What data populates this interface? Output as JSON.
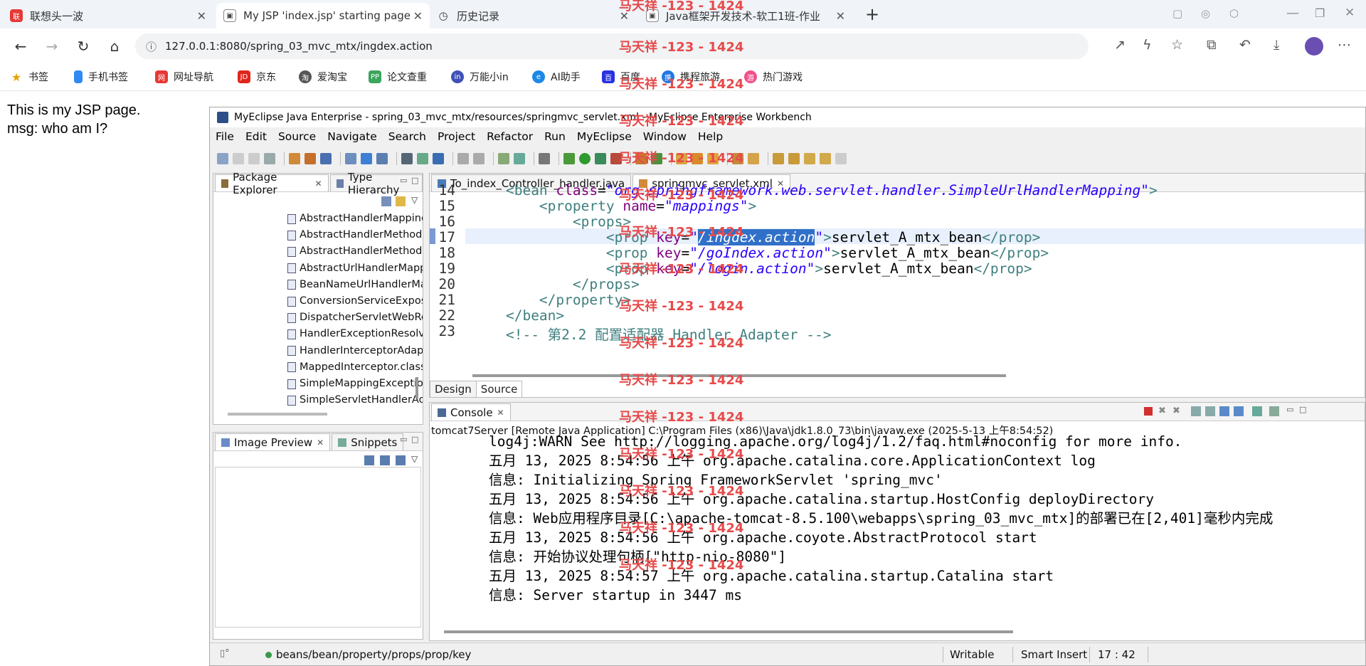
{
  "browser": {
    "tabs": [
      {
        "title": "联想头一波",
        "icon": "lenovo-icon"
      },
      {
        "title": "My JSP 'index.jsp' starting page",
        "icon": "page-icon"
      },
      {
        "title": "历史记录",
        "icon": "history-icon"
      },
      {
        "title": "Java框架开发技术-软工1班-作业",
        "icon": "page-icon"
      }
    ],
    "url": "127.0.0.1:8080/spring_03_mvc_mtx/ingdex.action",
    "bookmarks": [
      "书签",
      "手机书签",
      "网址导航",
      "京东",
      "爱淘宝",
      "论文查重",
      "万能小in",
      "AI助手",
      "百度",
      "携程旅游",
      "热门游戏"
    ]
  },
  "page": {
    "line1": "This is my JSP page.",
    "line2": "msg: who am I?"
  },
  "ide": {
    "title": "MyEclipse Java Enterprise - spring_03_mvc_mtx/resources/springmvc_servlet.xml - MyEclipse Enterprise Workbench",
    "menu": [
      "File",
      "Edit",
      "Source",
      "Navigate",
      "Search",
      "Project",
      "Refactor",
      "Run",
      "MyEclipse",
      "Window",
      "Help"
    ],
    "left_top_tabs": [
      "Package Explorer",
      "Type Hierarchy"
    ],
    "tree_items": [
      "AbstractHandlerMapping.class",
      "AbstractHandlerMethodExcepti",
      "AbstractHandlerMethodMappin",
      "AbstractUrlHandlerMapping.clas",
      "BeanNameUrlHandlerMapping.c",
      "ConversionServiceExposingInter",
      "DispatcherServletWebRequest.c",
      "HandlerExceptionResolverComp",
      "HandlerInterceptorAdapter.class",
      "MappedInterceptor.class",
      "SimpleMappingExceptionResolv",
      "SimpleServletHandlerAdapter.cl"
    ],
    "left_bottom_tabs": [
      "Image Preview",
      "Snippets"
    ],
    "editor_tabs": [
      "To_index_Controller_handler.java",
      "springmvc_servlet.xml"
    ],
    "code_lines": [
      {
        "n": "14",
        "indent": "    ",
        "text": "<bean class=\"org.springframework.web.servlet.handler.SimpleUrlHandlerMapping\">"
      },
      {
        "n": "15",
        "indent": "        ",
        "text": "<property name=\"mappings\">"
      },
      {
        "n": "16",
        "indent": "            ",
        "text": "<props>"
      },
      {
        "n": "17",
        "indent": "                ",
        "text": "<prop key=\"/ingdex.action\">servlet_A_mtx_bean</prop>"
      },
      {
        "n": "18",
        "indent": "                ",
        "text": "<prop key=\"/goIndex.action\">servlet_A_mtx_bean</prop>"
      },
      {
        "n": "19",
        "indent": "                ",
        "text": "<prop key=\"/login.action\">servlet_A_mtx_bean</prop>"
      },
      {
        "n": "20",
        "indent": "            ",
        "text": "</props>"
      },
      {
        "n": "21",
        "indent": "        ",
        "text": "</property>"
      },
      {
        "n": "22",
        "indent": "    ",
        "text": "</bean>"
      },
      {
        "n": "23",
        "indent": "    ",
        "text": "<!-- 第2.2 配置适配器 Handler Adapter -->"
      }
    ],
    "editor_bottom_tabs": [
      "Design",
      "Source"
    ],
    "console_tab": "Console",
    "console_header": "tomcat7Server [Remote Java Application] C:\\Program Files (x86)\\Java\\jdk1.8.0_73\\bin\\javaw.exe (2025-5-13 上午8:54:52)",
    "console_lines": [
      "log4j:WARN See http://logging.apache.org/log4j/1.2/faq.html#noconfig for more info.",
      "五月 13, 2025 8:54:56 上午 org.apache.catalina.core.ApplicationContext log",
      "信息: Initializing Spring FrameworkServlet 'spring_mvc'",
      "五月 13, 2025 8:54:56 上午 org.apache.catalina.startup.HostConfig deployDirectory",
      "信息: Web应用程序目录[C:\\apache-tomcat-8.5.100\\webapps\\spring_03_mvc_mtx]的部署已在[2,401]毫秒内完成",
      "五月 13, 2025 8:54:56 上午 org.apache.coyote.AbstractProtocol start",
      "信息: 开始协议处理句柄[\"http-nio-8080\"]",
      "五月 13, 2025 8:54:57 上午 org.apache.catalina.startup.Catalina start",
      "信息: Server startup in 3447 ms"
    ],
    "status": {
      "path": "beans/bean/property/props/prop/key",
      "writable": "Writable",
      "insert": "Smart Insert",
      "position": "17 : 42"
    }
  },
  "watermark": "马天祥 -123 - 1424",
  "colors": {
    "xml_tag": "#3f7f7f",
    "xml_attr": "#7f007f",
    "xml_value": "#2a00ff",
    "watermark": "#e74a4a",
    "selection": "#3070c8"
  }
}
